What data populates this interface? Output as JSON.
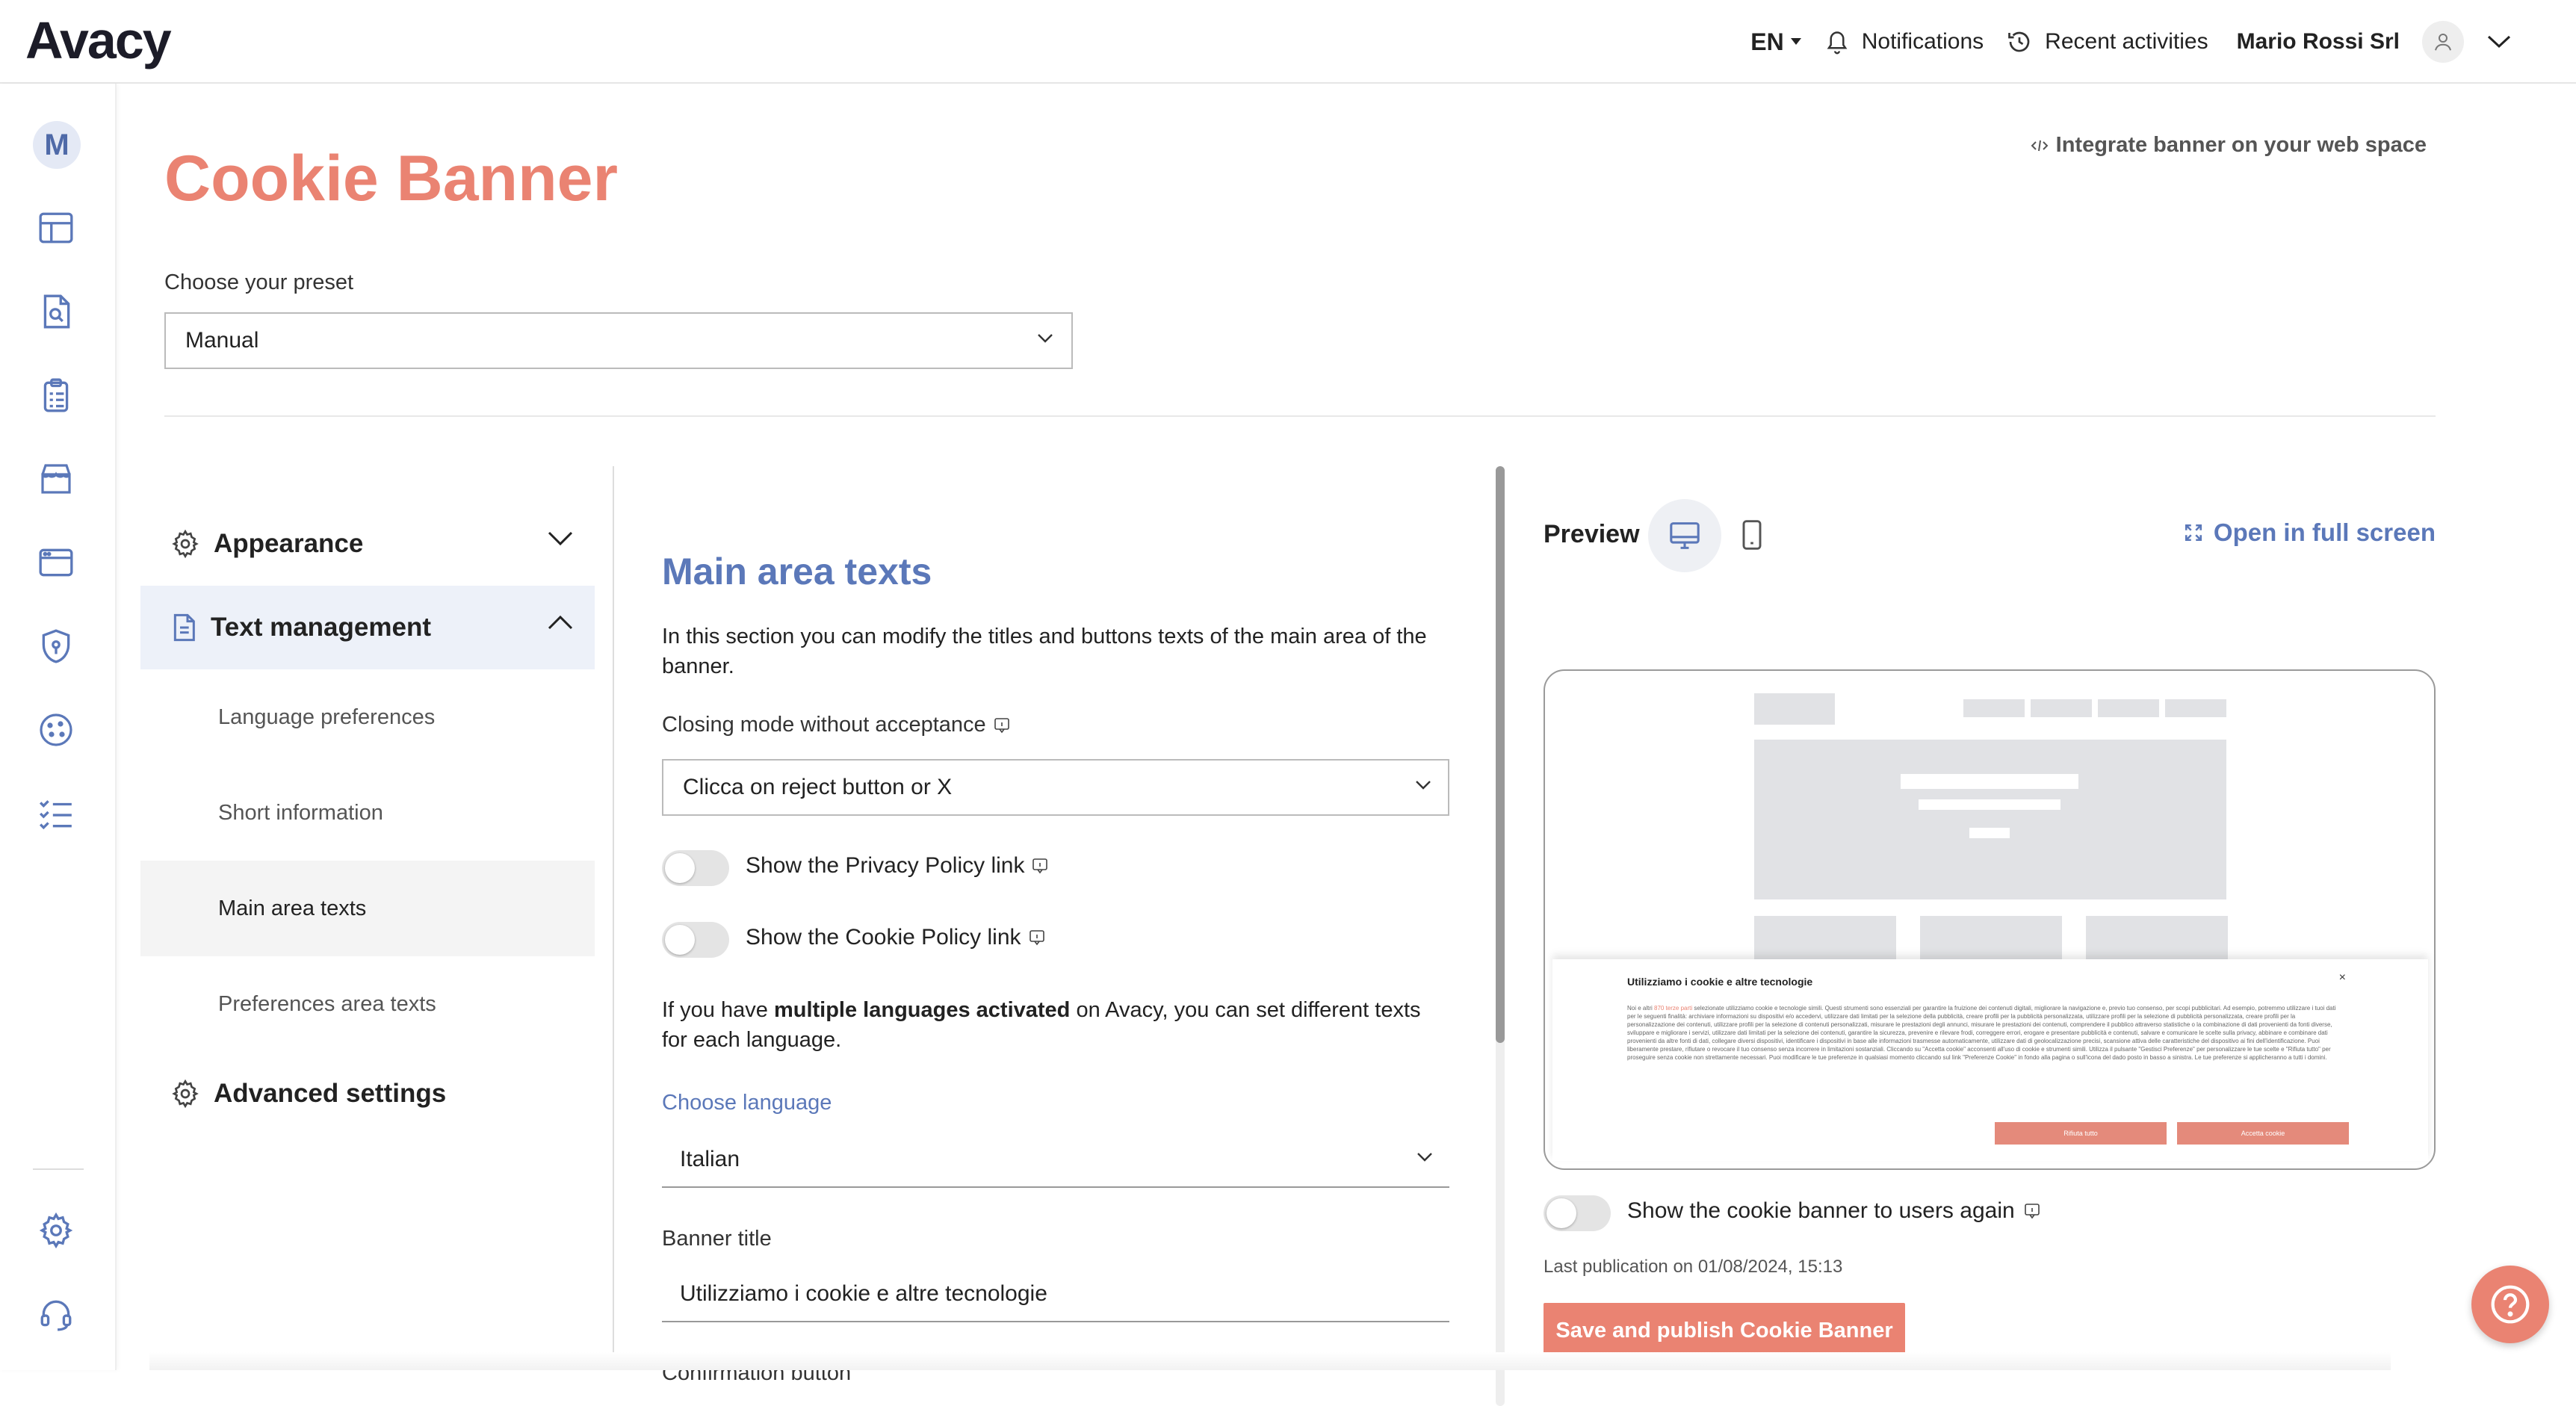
{
  "app": {
    "logo": "Avacy"
  },
  "topbar": {
    "language": "EN",
    "notifications": "Notifications",
    "recent": "Recent activities",
    "company": "Mario Rossi Srl"
  },
  "sidebar": {
    "avatar_letter": "M"
  },
  "page": {
    "title": "Cookie Banner",
    "integrate": "Integrate banner on your web space",
    "preset_label": "Choose your preset",
    "preset_value": "Manual"
  },
  "menu": {
    "appearance": "Appearance",
    "text_management": "Text management",
    "items": [
      "Language preferences",
      "Short information",
      "Main area texts",
      "Preferences area texts"
    ],
    "advanced": "Advanced settings"
  },
  "content": {
    "title": "Main area texts",
    "intro": "In this section you can modify the titles and buttons texts of the main area of the banner.",
    "closing_label": "Closing mode without acceptance",
    "closing_value": "Clicca on reject button or X",
    "privacy_toggle": "Show the Privacy Policy link",
    "cookie_toggle": "Show the Cookie Policy link",
    "multi_pre": "If you have ",
    "multi_bold": "multiple languages activated",
    "multi_post": " on Avacy, you can set different texts for each language.",
    "choose_language": "Choose language",
    "language_value": "Italian",
    "banner_title_label": "Banner title",
    "banner_title_value": "Utilizziamo i cookie e altre tecnologie",
    "confirm_label": "Confirmation button"
  },
  "preview": {
    "title": "Preview",
    "fullscreen": "Open in full screen",
    "banner_title": "Utilizziamo i cookie e altre tecnologie",
    "banner_close": "×",
    "banner_text_pre": "Noi e altri ",
    "banner_text_link": "870 terze parti",
    "banner_text": " selezionate utilizziamo cookie e tecnologie simili. Questi strumenti sono essenziali per garantire la fruizione dei contenuti digitali, migliorare la navigazione e, previo tuo consenso, per scopi pubblicitari. Ad esempio, potremmo utilizzare i tuoi dati per le seguenti finalità: archiviare informazioni su dispositivi e/o accedervi, utilizzare dati limitati per la selezione della pubblicità, creare profili per la pubblicità personalizzata, utilizzare profili per la selezione di pubblicità personalizzata, creare profili per la personalizzazione dei contenuti, utilizzare profili per la selezione di contenuti personalizzati, misurare le prestazioni degli annunci, misurare le prestazioni dei contenuti, comprendere il pubblico attraverso statistiche o la combinazione di dati provenienti da fonti diverse, sviluppare e migliorare i servizi, utilizzare dati limitati per la selezione dei contenuti, garantire la sicurezza, prevenire e rilevare frodi, correggere errori, erogare e presentare pubblicità e contenuti, salvare e comunicare le scelte sulla privacy, abbinare e combinare dati provenienti da altre fonti di dati, collegare diversi dispositivi, identificare i dispositivi in base alle informazioni trasmesse automaticamente, utilizzare dati di geolocalizzazione precisi, scansione attiva delle caratteristiche del dispositivo ai fini dell'identificazione. Puoi liberamente prestare, rifiutare o revocare il tuo consenso senza incorrere in limitazioni sostanziali. Cliccando su \"Accetta cookie\" acconsenti all'uso di cookie e strumenti simili. Utilizza il pulsante \"Gestisci Preferenze\" per personalizzare le tue scelte e \"Rifiuta tutto\" per proseguire senza cookie non strettamente necessari. Puoi modificare le tue preferenze in qualsiasi momento cliccando sul link \"Preferenze Cookie\" in fondo alla pagina o sull'icona del dado posto in basso a sinistra. Le tue preferenze si applicheranno a tutti i domini.",
    "reject_btn": "Rifiuta tutto",
    "accept_btn": "Accetta cookie",
    "show_again": "Show the cookie banner to users again",
    "last_pub": "Last publication on 01/08/2024, 15:13",
    "save_btn": "Save and publish Cookie Banner"
  },
  "colors": {
    "brand": "#ea8372",
    "accent_blue": "#5b78b9"
  }
}
